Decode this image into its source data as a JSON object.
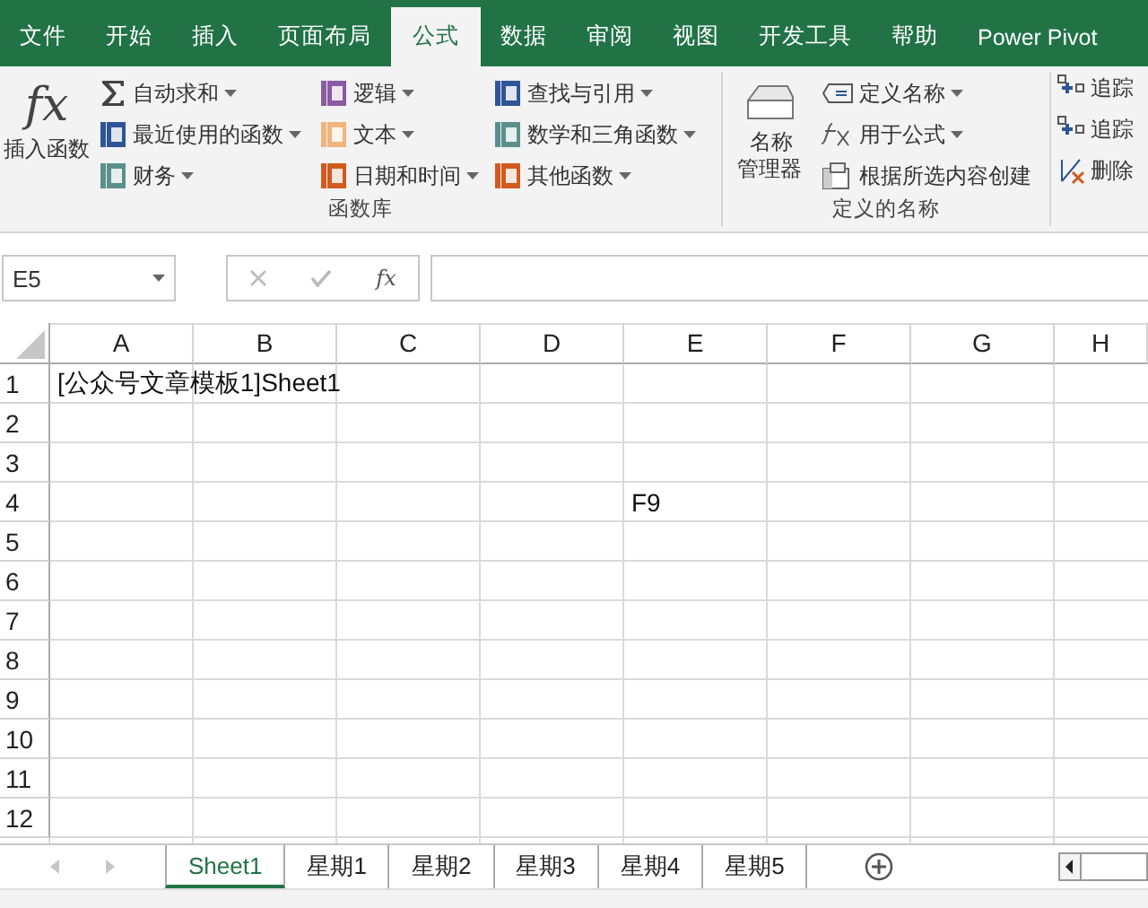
{
  "menu_tabs": [
    {
      "label": "文件",
      "selected": false
    },
    {
      "label": "开始",
      "selected": false
    },
    {
      "label": "插入",
      "selected": false
    },
    {
      "label": "页面布局",
      "selected": false
    },
    {
      "label": "公式",
      "selected": true
    },
    {
      "label": "数据",
      "selected": false
    },
    {
      "label": "审阅",
      "selected": false
    },
    {
      "label": "视图",
      "selected": false
    },
    {
      "label": "开发工具",
      "selected": false
    },
    {
      "label": "帮助",
      "selected": false
    },
    {
      "label": "Power Pivot",
      "selected": false
    }
  ],
  "ribbon": {
    "function_library": {
      "big_button": {
        "symbol": "fx",
        "label": "插入函数"
      },
      "columns": [
        [
          {
            "label": "自动求和",
            "dropdown": true
          },
          {
            "label": "最近使用的函数",
            "dropdown": true
          },
          {
            "label": "财务",
            "dropdown": true
          }
        ],
        [
          {
            "label": "逻辑",
            "dropdown": true
          },
          {
            "label": "文本",
            "dropdown": true
          },
          {
            "label": "日期和时间",
            "dropdown": true
          }
        ],
        [
          {
            "label": "查找与引用",
            "dropdown": true
          },
          {
            "label": "数学和三角函数",
            "dropdown": true
          },
          {
            "label": "其他函数",
            "dropdown": true
          }
        ]
      ],
      "title": "函数库"
    },
    "defined_names": {
      "big_button": {
        "label": "名称管理器"
      },
      "items": [
        {
          "label": "定义名称",
          "dropdown": true
        },
        {
          "label": "用于公式",
          "dropdown": true
        },
        {
          "label": "根据所选内容创建",
          "dropdown": false
        }
      ],
      "title": "定义的名称"
    },
    "formula_auditing": {
      "items": [
        {
          "label": "追踪"
        },
        {
          "label": "追踪"
        },
        {
          "label": "删除"
        }
      ]
    }
  },
  "formula_bar": {
    "name_box": "E5",
    "function_symbol": "fx"
  },
  "columns": [
    "A",
    "B",
    "C",
    "D",
    "E",
    "F",
    "G",
    "H"
  ],
  "rows": [
    {
      "label": "1",
      "cells": {
        "A": "[公众号文章模板1]Sheet1"
      }
    },
    {
      "label": "2"
    },
    {
      "label": "3"
    },
    {
      "label": "4",
      "cells": {
        "E": "F9"
      }
    },
    {
      "label": "5"
    },
    {
      "label": "6"
    },
    {
      "label": "7"
    },
    {
      "label": "8"
    },
    {
      "label": "9"
    },
    {
      "label": "10"
    },
    {
      "label": "11"
    },
    {
      "label": "12"
    }
  ],
  "sheet_tabs": [
    {
      "label": "Sheet1",
      "selected": true
    },
    {
      "label": "星期1",
      "selected": false
    },
    {
      "label": "星期2",
      "selected": false
    },
    {
      "label": "星期3",
      "selected": false
    },
    {
      "label": "星期4",
      "selected": false
    },
    {
      "label": "星期5",
      "selected": false
    }
  ]
}
